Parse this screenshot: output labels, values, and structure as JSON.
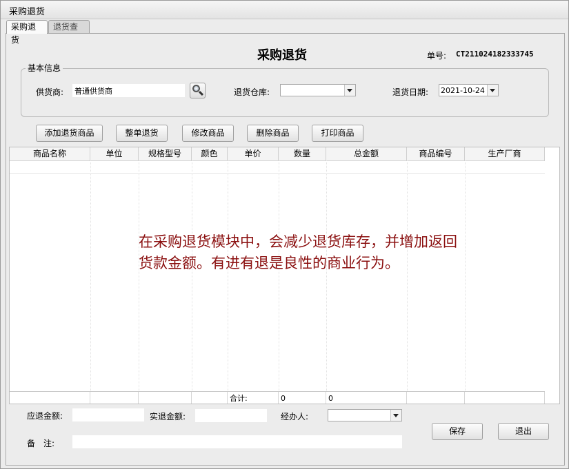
{
  "window": {
    "title": "采购退货"
  },
  "tabs": [
    {
      "label": "采购退货",
      "active": true
    },
    {
      "label": "退货查询",
      "active": false
    }
  ],
  "header": {
    "title": "采购退货",
    "order_label": "单号:",
    "order_value": "CT211024182333745"
  },
  "basic_info": {
    "legend": "基本信息",
    "supplier_label": "供货商:",
    "supplier_value": "普通供货商",
    "warehouse_label": "退货仓库:",
    "warehouse_value": "",
    "date_label": "退货日期:",
    "date_value": "2021-10-24"
  },
  "toolbar": {
    "add": "添加退货商品",
    "whole": "整单退货",
    "edit": "修改商品",
    "delete": "删除商品",
    "print": "打印商品"
  },
  "table": {
    "columns": [
      "商品名称",
      "单位",
      "规格型号",
      "颜色",
      "单价",
      "数量",
      "总金额",
      "商品编号",
      "生产厂商"
    ],
    "totals_label": "合计:",
    "total_qty": "0",
    "total_amount": "0"
  },
  "overlay_text": "在采购退货模块中，会减少退货库存，并增加返回货款金额。有进有退是良性的商业行为。",
  "footer": {
    "refund_due_label": "应退金额:",
    "refund_due_value": "",
    "refund_actual_label": "实退金额:",
    "refund_actual_value": "",
    "handler_label": "经办人:",
    "handler_value": "",
    "note_label": "备　注:",
    "note_value": "",
    "save": "保存",
    "exit": "退出"
  }
}
